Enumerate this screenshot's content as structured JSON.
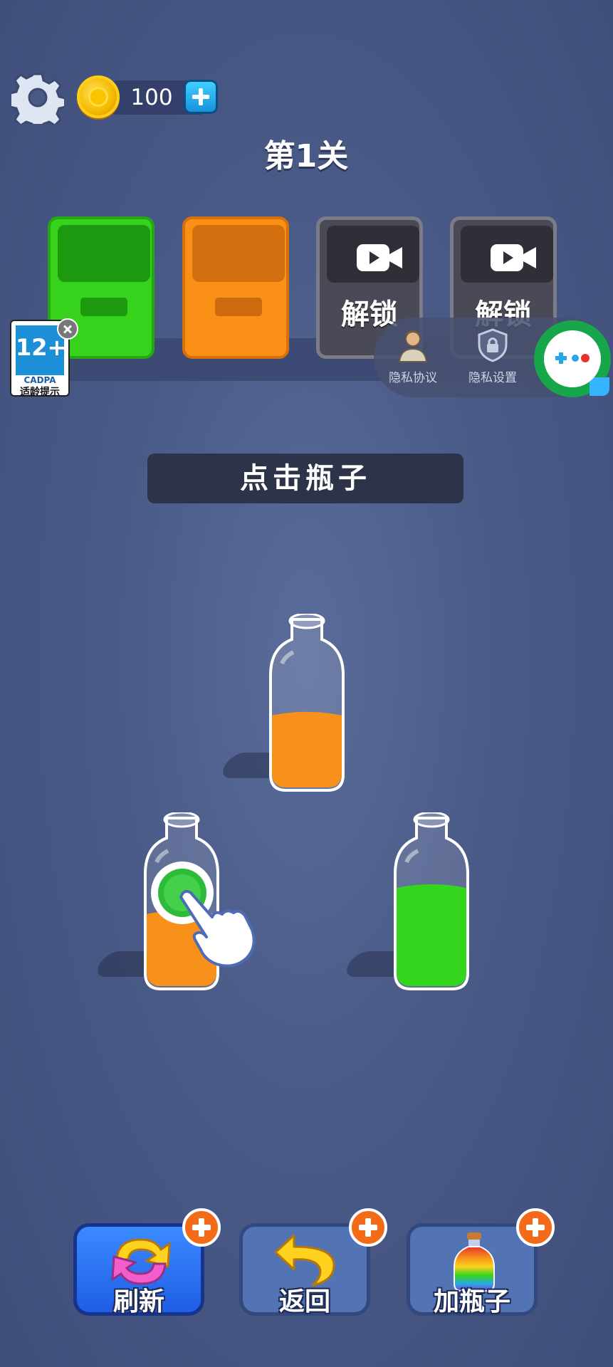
{
  "topbar": {
    "coins": "100",
    "level_title": "第1关"
  },
  "boxes": [
    {
      "color": "#36d21c",
      "state": "open"
    },
    {
      "color": "#fa9016",
      "state": "open"
    },
    {
      "label": "解锁",
      "state": "locked",
      "icon": "video-camera-icon"
    },
    {
      "label": "解锁",
      "state": "locked",
      "icon": "video-camera-icon"
    }
  ],
  "age_rating": {
    "age": "12+",
    "org": "CADPA",
    "hint": "适龄提示"
  },
  "privacy": {
    "agreement_label": "隐私协议",
    "settings_label": "隐私设置"
  },
  "instruction": "点击瓶子",
  "bottles": [
    {
      "liquid": "#f7911a",
      "fill": 0.55
    },
    {
      "liquid": "#f7911a",
      "fill": 0.55,
      "hint": "tap-hand"
    },
    {
      "liquid": "#33d61c",
      "fill": 0.75
    }
  ],
  "buttons": {
    "refresh_label": "刷新",
    "undo_label": "返回",
    "add_bottle_label": "加瓶子"
  },
  "colors": {
    "background": "#4a5a87",
    "orange": "#f7911a",
    "green": "#33d61c",
    "accent_plus": "#f36a18"
  }
}
